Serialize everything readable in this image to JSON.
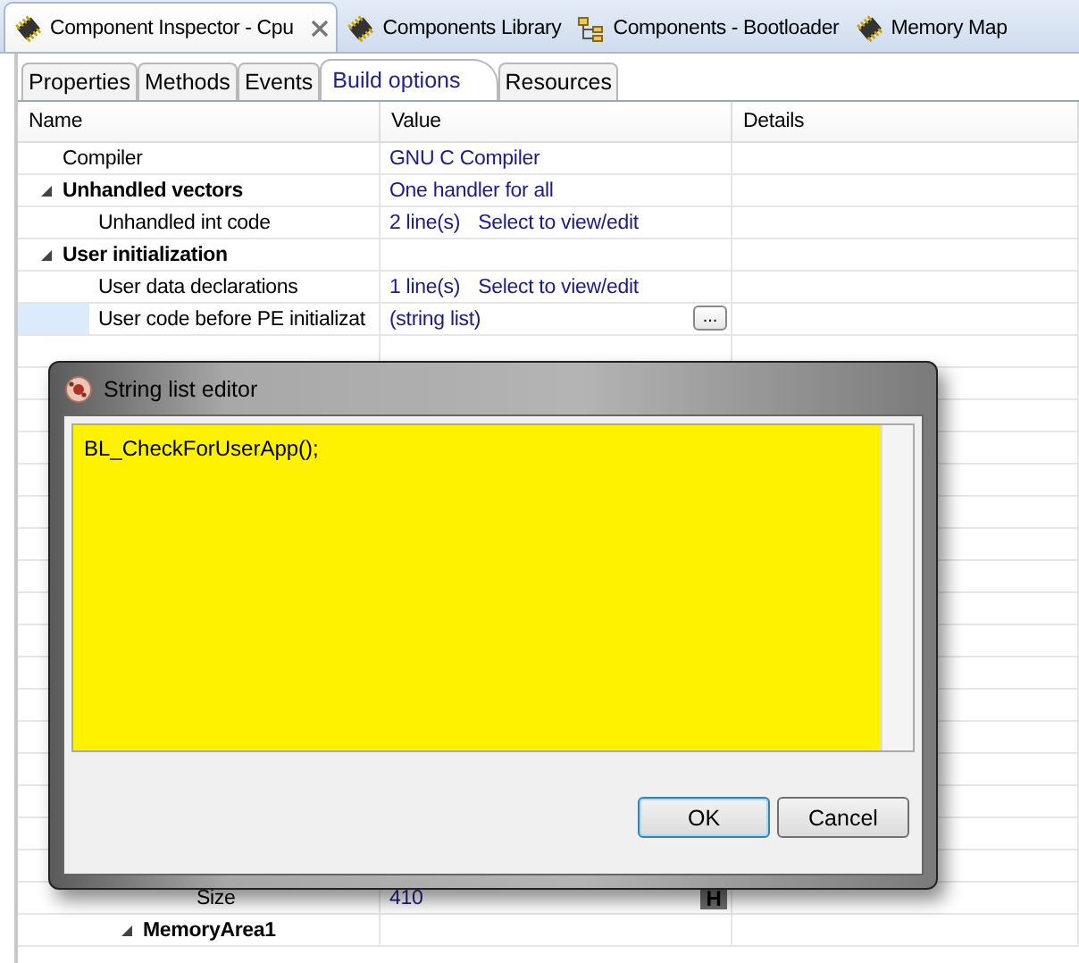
{
  "editor_tabs": [
    {
      "label": "Component Inspector - Cpu",
      "kind": "chip",
      "selected": true,
      "closable": true
    },
    {
      "label": "Components Library",
      "kind": "chip",
      "selected": false,
      "closable": false
    },
    {
      "label": "Components - Bootloader",
      "kind": "tree",
      "selected": false,
      "closable": false
    },
    {
      "label": "Memory Map",
      "kind": "chip",
      "selected": false,
      "closable": false
    }
  ],
  "property_tabs": [
    {
      "label": "Properties",
      "selected": false
    },
    {
      "label": "Methods",
      "selected": false
    },
    {
      "label": "Events",
      "selected": false
    },
    {
      "label": "Build options",
      "selected": true
    },
    {
      "label": "Resources",
      "selected": false
    }
  ],
  "table": {
    "columns": [
      "Name",
      "Value",
      "Details"
    ],
    "rows": [
      {
        "name": "Compiler",
        "value": "GNU C Compiler"
      },
      {
        "name": "Unhandled vectors",
        "value": "One handler for all",
        "expanded": true,
        "children": [
          {
            "name": "Unhandled int code",
            "value": "2 line(s)",
            "action": "Select to view/edit"
          }
        ]
      },
      {
        "name": "User initialization",
        "expanded": true,
        "children": [
          {
            "name": "User data declarations",
            "value": "1 line(s)",
            "action": "Select to view/edit"
          },
          {
            "name": "User code before PE initializat",
            "value": "(string list)",
            "button": "...",
            "selected": true
          }
        ]
      }
    ],
    "lower_rows": [
      {
        "name": "Size",
        "value": "410",
        "badge": "H"
      },
      {
        "name": "MemoryArea1",
        "expanded": true
      }
    ]
  },
  "dialog": {
    "title": "String list editor",
    "text": "BL_CheckForUserApp();",
    "buttons": [
      {
        "label": "OK",
        "default": true
      },
      {
        "label": "Cancel",
        "default": false
      }
    ]
  }
}
